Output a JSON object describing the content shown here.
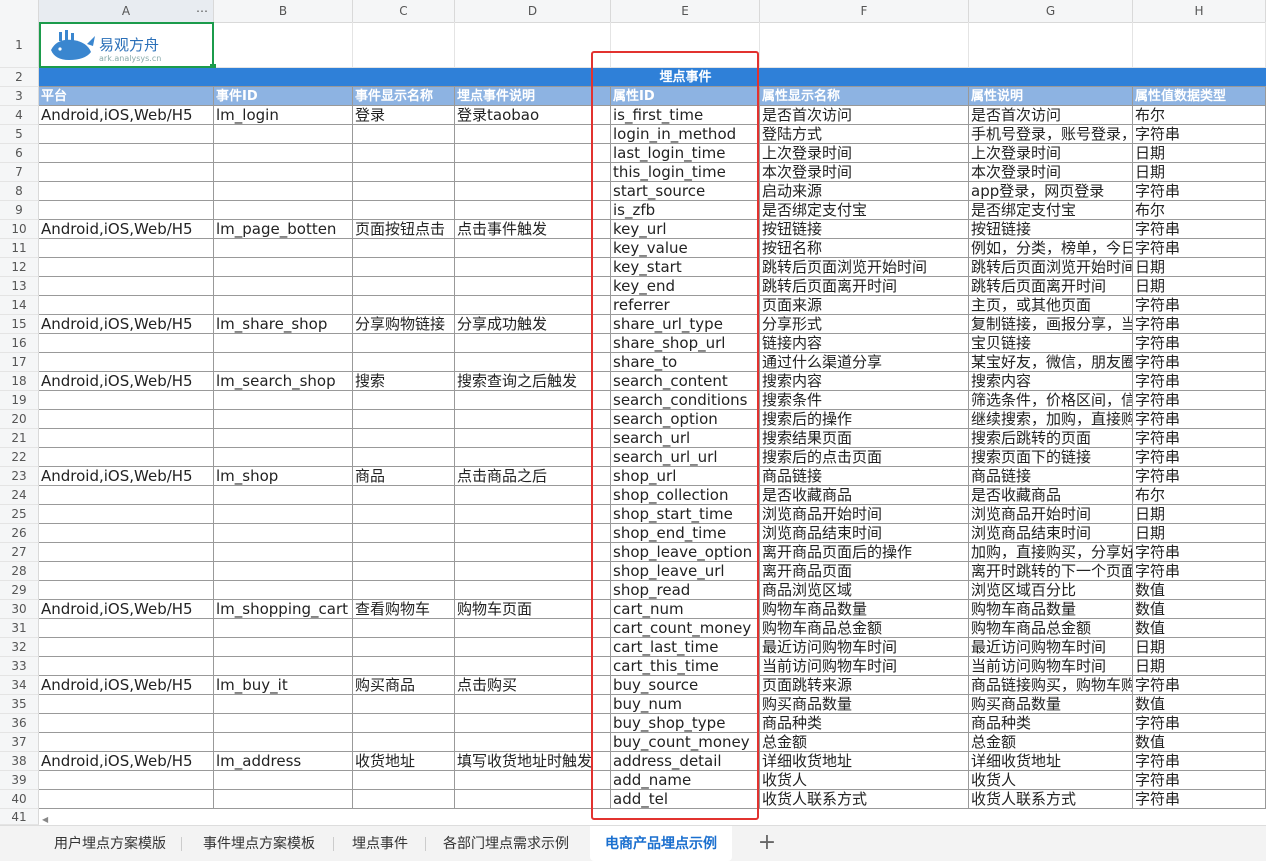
{
  "columns": [
    "A",
    "B",
    "C",
    "D",
    "E",
    "F",
    "G",
    "H"
  ],
  "logo": {
    "brand": "易观方舟",
    "url": "ark.analysys.cn"
  },
  "section_band": "埋点事件",
  "headers": [
    "平台",
    "事件ID",
    "事件显示名称",
    "埋点事件说明",
    "属性ID",
    "属性显示名称",
    "属性说明",
    "属性值数据类型"
  ],
  "rows": [
    {
      "n": 4,
      "a": "Android,iOS,Web/H5",
      "b": "lm_login",
      "c": "登录",
      "d": "登录taobao",
      "e": "is_first_time",
      "f": "是否首次访问",
      "g": "是否首次访问",
      "h": "布尔"
    },
    {
      "n": 5,
      "a": "",
      "b": "",
      "c": "",
      "d": "",
      "e": "login_in_method",
      "f": "登陆方式",
      "g": "手机号登录，账号登录，",
      "h": "字符串"
    },
    {
      "n": 6,
      "a": "",
      "b": "",
      "c": "",
      "d": "",
      "e": "last_login_time",
      "f": "上次登录时间",
      "g": "上次登录时间",
      "h": "日期"
    },
    {
      "n": 7,
      "a": "",
      "b": "",
      "c": "",
      "d": "",
      "e": "this_login_time",
      "f": "本次登录时间",
      "g": "本次登录时间",
      "h": "日期"
    },
    {
      "n": 8,
      "a": "",
      "b": "",
      "c": "",
      "d": "",
      "e": "start_source",
      "f": "启动来源",
      "g": "app登录，网页登录",
      "h": "字符串"
    },
    {
      "n": 9,
      "a": "",
      "b": "",
      "c": "",
      "d": "",
      "e": "is_zfb",
      "f": "是否绑定支付宝",
      "g": "是否绑定支付宝",
      "h": "布尔"
    },
    {
      "n": 10,
      "a": "Android,iOS,Web/H5",
      "b": "lm_page_botten",
      "c": "页面按钮点击",
      "d": "点击事件触发",
      "e": "key_url",
      "f": "按钮链接",
      "g": "按钮链接",
      "h": "字符串"
    },
    {
      "n": 11,
      "a": "",
      "b": "",
      "c": "",
      "d": "",
      "e": "key_value",
      "f": "按钮名称",
      "g": "例如，分类，榜单，今日",
      "h": "字符串"
    },
    {
      "n": 12,
      "a": "",
      "b": "",
      "c": "",
      "d": "",
      "e": "key_start",
      "f": "跳转后页面浏览开始时间",
      "g": "跳转后页面浏览开始时间",
      "h": "日期"
    },
    {
      "n": 13,
      "a": "",
      "b": "",
      "c": "",
      "d": "",
      "e": "key_end",
      "f": "跳转后页面离开时间",
      "g": "跳转后页面离开时间",
      "h": "日期"
    },
    {
      "n": 14,
      "a": "",
      "b": "",
      "c": "",
      "d": "",
      "e": "referrer",
      "f": "页面来源",
      "g": "主页，或其他页面",
      "h": "字符串"
    },
    {
      "n": 15,
      "a": "Android,iOS,Web/H5",
      "b": "lm_share_shop",
      "c": "分享购物链接",
      "d": "分享成功触发",
      "e": "share_url_type",
      "f": "分享形式",
      "g": "复制链接，画报分享，当",
      "h": "字符串"
    },
    {
      "n": 16,
      "a": "",
      "b": "",
      "c": "",
      "d": "",
      "e": "share_shop_url",
      "f": "链接内容",
      "g": "宝贝链接",
      "h": "字符串"
    },
    {
      "n": 17,
      "a": "",
      "b": "",
      "c": "",
      "d": "",
      "e": "share_to",
      "f": "通过什么渠道分享",
      "g": "某宝好友，微信，朋友圈",
      "h": "字符串"
    },
    {
      "n": 18,
      "a": "Android,iOS,Web/H5",
      "b": "lm_search_shop",
      "c": "搜索",
      "d": "搜索查询之后触发",
      "e": "search_content",
      "f": "搜索内容",
      "g": "搜索内容",
      "h": "字符串"
    },
    {
      "n": 19,
      "a": "",
      "b": "",
      "c": "",
      "d": "",
      "e": "search_conditions",
      "f": "搜索条件",
      "g": "筛选条件，价格区间，信",
      "h": "字符串"
    },
    {
      "n": 20,
      "a": "",
      "b": "",
      "c": "",
      "d": "",
      "e": "search_option",
      "f": "搜索后的操作",
      "g": "继续搜索，加购，直接购",
      "h": "字符串"
    },
    {
      "n": 21,
      "a": "",
      "b": "",
      "c": "",
      "d": "",
      "e": "search_url",
      "f": "搜索结果页面",
      "g": "搜索后跳转的页面",
      "h": "字符串"
    },
    {
      "n": 22,
      "a": "",
      "b": "",
      "c": "",
      "d": "",
      "e": "search_url_url",
      "f": "搜索后的点击页面",
      "g": "搜索页面下的链接",
      "h": "字符串"
    },
    {
      "n": 23,
      "a": "Android,iOS,Web/H5",
      "b": "lm_shop",
      "c": "商品",
      "d": "点击商品之后",
      "e": "shop_url",
      "f": "商品链接",
      "g": "商品链接",
      "h": "字符串"
    },
    {
      "n": 24,
      "a": "",
      "b": "",
      "c": "",
      "d": "",
      "e": "shop_collection",
      "f": "是否收藏商品",
      "g": "是否收藏商品",
      "h": "布尔"
    },
    {
      "n": 25,
      "a": "",
      "b": "",
      "c": "",
      "d": "",
      "e": "shop_start_time",
      "f": "浏览商品开始时间",
      "g": "浏览商品开始时间",
      "h": "日期"
    },
    {
      "n": 26,
      "a": "",
      "b": "",
      "c": "",
      "d": "",
      "e": "shop_end_time",
      "f": "浏览商品结束时间",
      "g": "浏览商品结束时间",
      "h": "日期"
    },
    {
      "n": 27,
      "a": "",
      "b": "",
      "c": "",
      "d": "",
      "e": "shop_leave_option",
      "f": "离开商品页面后的操作",
      "g": "加购，直接购买，分享好",
      "h": "字符串"
    },
    {
      "n": 28,
      "a": "",
      "b": "",
      "c": "",
      "d": "",
      "e": "shop_leave_url",
      "f": "离开商品页面",
      "g": "离开时跳转的下一个页面",
      "h": "字符串"
    },
    {
      "n": 29,
      "a": "",
      "b": "",
      "c": "",
      "d": "",
      "e": "shop_read",
      "f": "商品浏览区域",
      "g": "浏览区域百分比",
      "h": "数值"
    },
    {
      "n": 30,
      "a": "Android,iOS,Web/H5",
      "b": "lm_shopping_cart",
      "c": "查看购物车",
      "d": "购物车页面",
      "e": "cart_num",
      "f": "购物车商品数量",
      "g": "购物车商品数量",
      "h": "数值"
    },
    {
      "n": 31,
      "a": "",
      "b": "",
      "c": "",
      "d": "",
      "e": "cart_count_money",
      "f": "购物车商品总金额",
      "g": "购物车商品总金额",
      "h": "数值"
    },
    {
      "n": 32,
      "a": "",
      "b": "",
      "c": "",
      "d": "",
      "e": "cart_last_time",
      "f": "最近访问购物车时间",
      "g": "最近访问购物车时间",
      "h": "日期"
    },
    {
      "n": 33,
      "a": "",
      "b": "",
      "c": "",
      "d": "",
      "e": "cart_this_time",
      "f": "当前访问购物车时间",
      "g": "当前访问购物车时间",
      "h": "日期"
    },
    {
      "n": 34,
      "a": "Android,iOS,Web/H5",
      "b": "lm_buy_it",
      "c": "购买商品",
      "d": "点击购买",
      "e": "buy_source",
      "f": "页面跳转来源",
      "g": "商品链接购买，购物车购",
      "h": "字符串"
    },
    {
      "n": 35,
      "a": "",
      "b": "",
      "c": "",
      "d": "",
      "e": "buy_num",
      "f": "购买商品数量",
      "g": "购买商品数量",
      "h": "数值"
    },
    {
      "n": 36,
      "a": "",
      "b": "",
      "c": "",
      "d": "",
      "e": "buy_shop_type",
      "f": "商品种类",
      "g": "商品种类",
      "h": "字符串"
    },
    {
      "n": 37,
      "a": "",
      "b": "",
      "c": "",
      "d": "",
      "e": "buy_count_money",
      "f": "总金额",
      "g": "总金额",
      "h": "数值"
    },
    {
      "n": 38,
      "a": "Android,iOS,Web/H5",
      "b": "lm_address",
      "c": "收货地址",
      "d": "填写收货地址时触发",
      "e": "address_detail",
      "f": "详细收货地址",
      "g": "详细收货地址",
      "h": "字符串"
    },
    {
      "n": 39,
      "a": "",
      "b": "",
      "c": "",
      "d": "",
      "e": "add_name",
      "f": "收货人",
      "g": "收货人",
      "h": "字符串"
    },
    {
      "n": 40,
      "a": "",
      "b": "",
      "c": "",
      "d": "",
      "e": "add_tel",
      "f": "收货人联系方式",
      "g": "收货人联系方式",
      "h": "字符串"
    }
  ],
  "last_row_number": 41,
  "tabs": [
    "用户埋点方案模版",
    "事件埋点方案模板",
    "埋点事件",
    "各部门埋点需求示例",
    "电商产品埋点示例"
  ],
  "active_tab": 4,
  "add_tab_label": "+",
  "colors": {
    "header_bg": "#8db3e2",
    "band_bg": "#2f80d8",
    "highlight": "#e2322f",
    "active_tab_text": "#1a6fcf"
  }
}
